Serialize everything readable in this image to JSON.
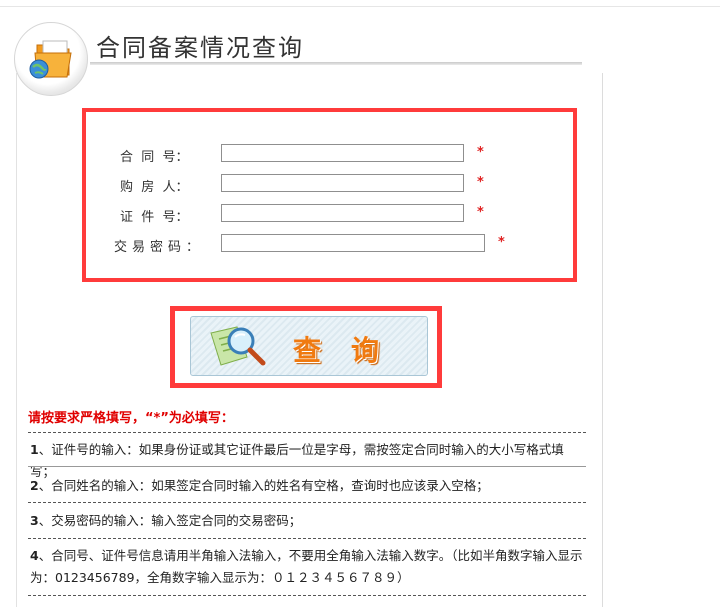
{
  "header": {
    "title": "合同备案情况查询"
  },
  "form": {
    "fields": [
      {
        "label": "合  同  号：",
        "required_mark": "*"
      },
      {
        "label": "购  房  人：",
        "required_mark": "*"
      },
      {
        "label": "证  件  号：",
        "required_mark": "*"
      },
      {
        "label": "交易密码：",
        "required_mark": "*"
      }
    ],
    "fields_values": [
      "",
      "",
      "",
      ""
    ]
  },
  "query_button": {
    "label": "查询",
    "icon": "magnifier-document-icon"
  },
  "instructions": {
    "heading": "请按要求严格填写，“*”为必填写：",
    "items": [
      {
        "num": "1",
        "text": "、证件号的输入：如果身份证或其它证件最后一位是字母，需按签定合同时输入的大小写格式填写；"
      },
      {
        "num": "2",
        "text": "、合同姓名的输入：如果签定合同时输入的姓名有空格，查询时也应该录入空格；"
      },
      {
        "num": "3",
        "text": "、交易密码的输入：输入签定合同的交易密码；"
      },
      {
        "num": "4",
        "text": "、合同号、证件号信息请用半角输入法输入，不要用全角输入法输入数字。（比如半角数字输入显示为：0123456789，全角数字输入显示为：０１２３４５６７８９）"
      }
    ]
  },
  "colors": {
    "highlight_border": "#ff3b3b",
    "required": "#e02020",
    "button_text": "#f07a10"
  }
}
